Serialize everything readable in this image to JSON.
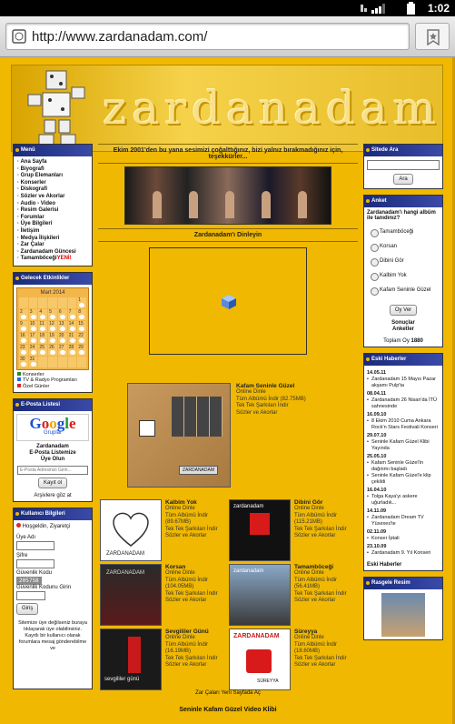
{
  "status": {
    "time": "1:02"
  },
  "browser": {
    "url": "http://www.zardanadam.com/"
  },
  "banner": {
    "logo": "zardanadam"
  },
  "left": {
    "menu_title": "Menü",
    "menu": [
      "· Ana Sayfa",
      "· Biyografi",
      "· Grup Elemanları",
      "· Konserler",
      "· Diskografi",
      "· Sözler ve Akorlar",
      "· Audio - Video",
      "· Resim Galerisi",
      "· Forumlar",
      "· Üye Bilgileri",
      "· İletişim",
      "· Medya İlişkileri",
      "· Zar Çalar",
      "· Zardanadam Güncesi",
      "· Tamamböceği"
    ],
    "menu_badge": "YENİ!",
    "events_title": "Gelecek Etkinlikler",
    "cal_month": "Mart 2014",
    "cal_days": [
      "",
      "",
      "",
      "",
      "",
      "",
      "1",
      "2",
      "3",
      "4",
      "5",
      "6",
      "7",
      "8",
      "9",
      "10",
      "11",
      "12",
      "13",
      "14",
      "15",
      "16",
      "17",
      "18",
      "19",
      "20",
      "21",
      "22",
      "23",
      "24",
      "25",
      "26",
      "27",
      "28",
      "29",
      "30",
      "31",
      "",
      "",
      "",
      "",
      ""
    ],
    "legend": [
      "Konserler",
      "TV & Radyo Programları",
      "Özel Günler"
    ],
    "list_title": "E-Posta Listesi",
    "google_sub": "Gruplar",
    "list_text1": "Zardanadam",
    "list_text2": "E-Posta Listemize",
    "list_text3": "Üye Olun",
    "list_placeholder": "E-Posta Adresinizi Girin...",
    "list_button": "Kayıt ol",
    "list_link": "Arşivlere göz at",
    "user_title": "Kullanıcı Bilgileri",
    "user_hello": "Hoşgeldin, Ziyaretçi",
    "user_name": "Üye Adı",
    "user_pass": "Şifre",
    "user_code_label": "Güvenlik Kodu",
    "user_code": "205758",
    "user_code_input": "Güvenlik Kodunu Girin",
    "user_button": "Giriş",
    "user_note": "Sitemize üye değilseniz buraya tıklayarak üye olabilirsiniz. Kayıtlı bir kullanıcı olarak forumlara mesaj gönderebilme ve"
  },
  "main": {
    "tagline": "Ekim 2001'den bu yana sesimizi çoğalttığınız, bizi yalnız bırakmadığınız için, teşekkürler...",
    "listen_title": "Zardanadam'ı Dinleyin",
    "featured": {
      "title": "Kafam Seninle Güzel",
      "lines": [
        "Online Dinle",
        "Tüm Albümü İndir (82.75MB)",
        "Tek Tek Şarkıları İndir",
        "Sözler ve Akorlar"
      ],
      "cover_text": "ZARDANADAM"
    },
    "albums": [
      {
        "title": "Kalbim Yok",
        "lines": [
          "Online Dinle",
          "Tüm Albümü İndir",
          "(89.67MB)",
          "Tek Tek Şarkıları İndir",
          "Sözler ve Akorlar"
        ]
      },
      {
        "title": "Dibini Gör",
        "lines": [
          "Online Dinle",
          "Tüm Albümü İndir",
          "(115.21MB)",
          "Tek Tek Şarkıları İndir",
          "Sözler ve Akorlar"
        ]
      },
      {
        "title": "Korsan",
        "lines": [
          "Online Dinle",
          "Tüm Albümü İndir",
          "(104.05MB)",
          "Tek Tek Şarkıları İndir",
          "Sözler ve Akorlar"
        ]
      },
      {
        "title": "Tamamböceği",
        "lines": [
          "Online Dinle",
          "Tüm Albümü İndir",
          "(56.41MB)",
          "Tek Tek Şarkıları İndir",
          "Sözler ve Akorlar"
        ]
      },
      {
        "title": "Sevgililer Günü",
        "lines": [
          "Online Dinle",
          "Tüm Albümü İndir",
          "(16.19MB)",
          "Tek Tek Şarkıları İndir",
          "Sözler ve Akorlar"
        ]
      },
      {
        "title": "Süreyya",
        "lines": [
          "Online Dinle",
          "Tüm Albümü İndir",
          "(18.60MB)",
          "Tek Tek Şarkıları İndir",
          "Sözler ve Akorlar"
        ]
      }
    ],
    "cover_labels": {
      "c1": "ZARDANADAM",
      "c2": "zardanadam",
      "c3": "ZARDANADAM",
      "c4": "zardanadam",
      "c5": "sevgililer günü",
      "c6": "ZARDANADAM",
      "c6b": "SÜREYYA"
    },
    "player_link": "Zar Çaları Yeni Sayfada Aç",
    "video_title": "Seninle Kafam Güzel Video Klibi"
  },
  "right": {
    "search_title": "Sitede Ara",
    "search_button": "Ara",
    "poll_title": "Anket",
    "poll_question": "Zardanadam'ı hangi albüm ile tanıdınız?",
    "poll_options": [
      "Tamamböceği",
      "Korsan",
      "Dibini Gör",
      "Kalbim Yok",
      "Kafam Seninle Güzel"
    ],
    "poll_button": "Oy Ver",
    "poll_results": "Sonuçlar",
    "poll_polls": "Anketler",
    "poll_total_label": "Toplam Oy",
    "poll_total": "1880",
    "news_title": "Eski Haberler",
    "news": [
      {
        "date": "14.05.11",
        "text": "Zardanadam 15 Mayıs Pazar akşamı Pulp'ta"
      },
      {
        "date": "08.04.11",
        "text": "Zardanadam 26 Nisan'da İTÜ sahnesinde"
      },
      {
        "date": "16.09.10",
        "text": "8 Ekim 2010 Cuma Ankara Rock'n Stars Festivali Konseri"
      },
      {
        "date": "29.07.10",
        "text": "Seninle Kafam Güzel Klibi Yayında"
      },
      {
        "date": "25.05.10",
        "text": "Kafam Seninle Güzel'in dağıtımı başladı"
      },
      {
        "date": "",
        "text": "Seninle Kafam Güzel'e klip çekildi"
      },
      {
        "date": "16.04.10",
        "text": "Tolga Kaya'yı askere uğurladık..."
      },
      {
        "date": "14.11.09",
        "text": "Zardanadam Dream TV Yüxexes'te"
      },
      {
        "date": "02.11.09",
        "text": "Konser İptali"
      },
      {
        "date": "23.10.09",
        "text": "Zardanadam 9. Yıl Konseri"
      }
    ],
    "news_footer": "Eski Haberler",
    "photo_title": "Rasgele Resim"
  },
  "colors": {
    "page_bg": "#f0b800",
    "header_bar": "#1a2a7a"
  }
}
